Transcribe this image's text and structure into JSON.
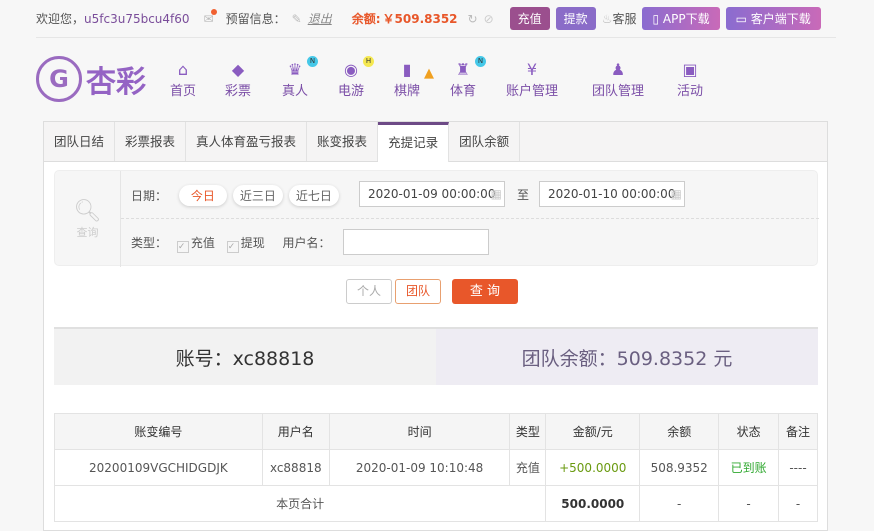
{
  "top": {
    "welcome": "欢迎您，",
    "username": "u5fc3u75bcu4f60",
    "reserved": "预留信息：",
    "logout": "退出",
    "balance_label": "余额:",
    "balance": "￥509.8352",
    "deposit": "充值",
    "withdraw": "提款",
    "service": "客服",
    "app": "APP下载",
    "client": "客户端下载"
  },
  "logo": {
    "text": "杏彩"
  },
  "nav": [
    {
      "label": "首页",
      "icon": "home-icon",
      "g": "⌂"
    },
    {
      "label": "彩票",
      "icon": "ticket-icon",
      "g": "◆"
    },
    {
      "label": "真人",
      "icon": "live-dealer-icon",
      "g": "♛",
      "badge": "N"
    },
    {
      "label": "电游",
      "icon": "gamepad-icon",
      "g": "◉",
      "badge": "H"
    },
    {
      "label": "棋牌",
      "icon": "cards-icon",
      "g": "▮"
    },
    {
      "label": "体育",
      "icon": "trophy-icon",
      "g": "♜",
      "badge": "N"
    },
    {
      "label": "账户管理",
      "icon": "yen-coin-icon",
      "g": "¥"
    },
    {
      "label": "团队管理",
      "icon": "team-icon",
      "g": "♟"
    },
    {
      "label": "活动",
      "icon": "gift-icon",
      "g": "▣"
    }
  ],
  "tabs": [
    "团队日结",
    "彩票报表",
    "真人体育盈亏报表",
    "账变报表",
    "充提记录",
    "团队余额"
  ],
  "filter": {
    "query": "查询",
    "date_label": "日期：",
    "today": "今日",
    "three": "近三日",
    "seven": "近七日",
    "start": "2020-01-09 00:00:00",
    "to": "至",
    "end": "2020-01-10 00:00:00",
    "type_label": "类型：",
    "deposit": "充值",
    "withdraw": "提现",
    "user_label": "用户名：",
    "user_value": "",
    "personal": "个人",
    "team": "团队",
    "search": "查 询"
  },
  "account": {
    "account_text": "账号：xc88818",
    "team_balance": "团队余额：509.8352 元"
  },
  "table": {
    "headers": [
      "账变编号",
      "用户名",
      "时间",
      "类型",
      "金额/元",
      "余额",
      "状态",
      "备注"
    ],
    "rows": [
      [
        "20200109VGCHIDGDJK",
        "xc88818",
        "2020-01-09 10:10:48",
        "充值",
        "+500.0000",
        "508.9352",
        "已到账",
        "----"
      ]
    ],
    "total": {
      "label": "本页合计",
      "amount": "500.0000",
      "balance": "-",
      "status": "-",
      "note": "-"
    }
  },
  "colors": {
    "accent": "#8a5cc0",
    "orange": "#e8572a",
    "green": "#2fa82f"
  }
}
